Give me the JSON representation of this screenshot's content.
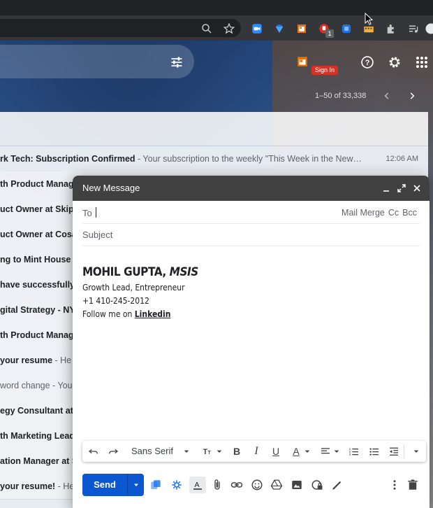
{
  "header": {
    "sign_in": "Sign In",
    "pager": "1–50 of 33,338"
  },
  "messages": [
    {
      "sender": "rk Tech: Subscription Confirmed",
      "snippet": " - Your subscription to the weekly \"This Week in the New…",
      "time": "12:06 AM"
    },
    {
      "sender": "th Product Manag",
      "snippet": ""
    },
    {
      "sender": "uct Owner at Skipit",
      "snippet": ""
    },
    {
      "sender": "uct Owner at Cosán",
      "snippet": ""
    },
    {
      "sender": "ng to Mint House",
      "snippet": " -"
    },
    {
      "sender": " have successfully",
      "snippet": ""
    },
    {
      "sender": "gital Strategy - NY",
      "snippet": ""
    },
    {
      "sender": "th Product Manag",
      "snippet": ""
    },
    {
      "sender": " your resume",
      "snippet": " - He"
    },
    {
      "sender": "word change",
      "snippet": " - You",
      "read": true
    },
    {
      "sender": "egy Consultant at I",
      "snippet": ""
    },
    {
      "sender": "th Marketing Lead",
      "snippet": ""
    },
    {
      "sender": "ation Manager at S",
      "snippet": ""
    },
    {
      "sender": " your resume!",
      "snippet": " - He"
    }
  ],
  "compose": {
    "title": "New Message",
    "to_label": "To",
    "mail_merge": "Mail Merge",
    "cc": "Cc",
    "bcc": "Bcc",
    "subject_placeholder": "Subject",
    "signature": {
      "name": "MOHIL GUPTA, ",
      "credential": "MSIS",
      "line1": "Growth Lead, Entrepreneur",
      "line2": "+1 410-245-2012",
      "line3_prefix": "Follow me on ",
      "link": "Linkedin"
    },
    "font": "Sans Serif",
    "send": "Send"
  },
  "colors": {
    "send_blue": "#0b57d0",
    "compose_header": "#404040",
    "signin_red": "#d93025"
  }
}
